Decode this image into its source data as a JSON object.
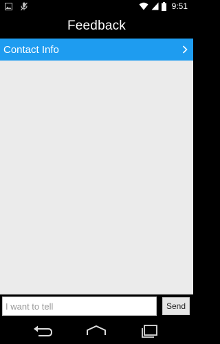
{
  "status_bar": {
    "time": "9:51",
    "icons": [
      "image-notification-icon",
      "microphone-off-icon",
      "wifi-icon",
      "signal-icon",
      "battery-icon"
    ]
  },
  "header": {
    "title": "Feedback"
  },
  "contact_row": {
    "label": "Contact Info",
    "icon": "chevron-right-icon"
  },
  "composer": {
    "input_value": "",
    "input_placeholder": "I want to tell",
    "send_label": "Send"
  },
  "nav_bar": {
    "icons": [
      "back-icon",
      "home-icon",
      "recent-apps-icon"
    ]
  },
  "colors": {
    "accent": "#1e9cf0",
    "content_background": "#ebebeb",
    "bars": "#000000"
  }
}
